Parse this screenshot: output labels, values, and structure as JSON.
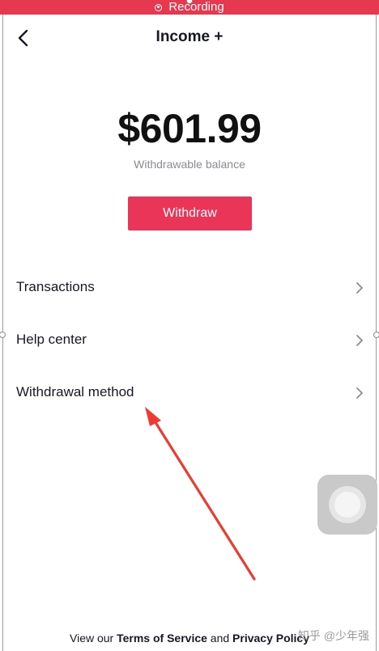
{
  "status_bar": {
    "recording_label": "Recording"
  },
  "header": {
    "title": "Income +"
  },
  "balance": {
    "amount": "$601.99",
    "label": "Withdrawable balance"
  },
  "actions": {
    "withdraw_label": "Withdraw"
  },
  "menu": [
    {
      "label": "Transactions"
    },
    {
      "label": "Help center"
    },
    {
      "label": "Withdrawal method"
    }
  ],
  "footer": {
    "prefix": "View our ",
    "terms_label": "Terms of Service",
    "conjunction": " and ",
    "privacy_label": "Privacy Policy"
  },
  "watermark": {
    "text": "知乎 @少年强"
  },
  "colors": {
    "recording_bar": "#e6384f",
    "accent": "#ea3458",
    "annotation_arrow": "#ee3a2f"
  }
}
